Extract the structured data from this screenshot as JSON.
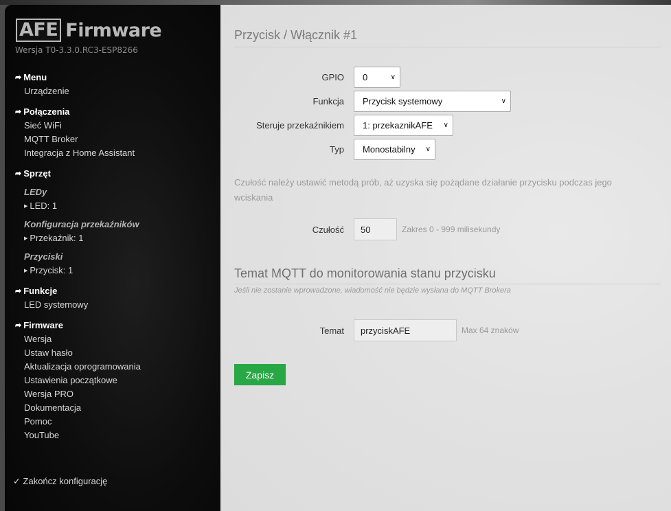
{
  "sidebar": {
    "logo_box": "AFE",
    "logo_text": "Firmware",
    "version": "Wersja T0-3.3.0.RC3-ESP8266",
    "sections": {
      "menu": {
        "title": "Menu",
        "items": [
          "Urządzenie"
        ]
      },
      "polaczenia": {
        "title": "Połączenia",
        "items": [
          "Sieć WiFi",
          "MQTT Broker",
          "Integracja z Home Assistant"
        ]
      },
      "sprzet": {
        "title": "Sprzęt",
        "groups": [
          {
            "title": "LEDy",
            "item": "LED: 1"
          },
          {
            "title": "Konfiguracja przekaźników",
            "item": "Przekaźnik: 1"
          },
          {
            "title": "Przyciski",
            "item": "Przycisk: 1"
          }
        ]
      },
      "funkcje": {
        "title": "Funkcje",
        "items": [
          "LED systemowy"
        ]
      },
      "firmware": {
        "title": "Firmware",
        "items": [
          "Wersja",
          "Ustaw hasło",
          "Aktualizacja oprogramowania",
          "Ustawienia początkowe",
          "Wersja PRO",
          "Dokumentacja",
          "Pomoc",
          "YouTube"
        ]
      }
    },
    "finish": "Zakończ konfigurację"
  },
  "main": {
    "title": "Przycisk / Włącznik #1",
    "fields": {
      "gpio": {
        "label": "GPIO",
        "value": "0"
      },
      "funkcja": {
        "label": "Funkcja",
        "value": "Przycisk systemowy"
      },
      "steruje": {
        "label": "Steruje przekaźnikiem",
        "value": "1: przekaznikAFE"
      },
      "typ": {
        "label": "Typ",
        "value": "Monostabilny"
      }
    },
    "note": "Czułość należy ustawić metodą prób, aż uzyska się pożądane działanie przycisku podczas jego wciskania",
    "czulosc": {
      "label": "Czułość",
      "value": "50",
      "hint": "Zakres 0 - 999 milisekundy"
    },
    "mqtt": {
      "title": "Temat MQTT do monitorowania stanu przycisku",
      "note": "Jeśli nie zostanie wprowadzone, wiadomość nie będzie wysłana do MQTT Brokera",
      "label": "Temat",
      "value": "przyciskAFE",
      "hint": "Max 64 znaków"
    },
    "save_label": "Zapisz"
  },
  "icons": {
    "section_arrow": "hand-right-arrow-icon",
    "sub_arrow": "triangle-right-icon",
    "finish": "checkmark-icon",
    "dropdown": "chevron-down-icon"
  },
  "colors": {
    "sidebar_bg": "#0d0d0d",
    "main_bg": "#e2e2e2",
    "save_button": "#28a745"
  }
}
